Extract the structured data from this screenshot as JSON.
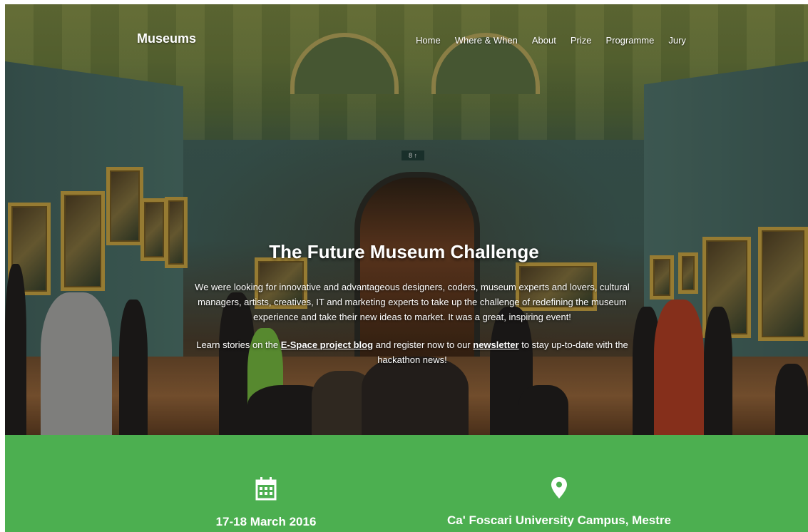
{
  "brand": "Museums",
  "nav": [
    "Home",
    "Where & When",
    "About",
    "Prize",
    "Programme",
    "Jury"
  ],
  "hero": {
    "title": "The Future Museum Challenge",
    "description": "We were looking for innovative and advantageous designers, coders, museum experts and lovers, cultural managers,  artists, creatives, IT and marketing experts to take up the challenge of redefining the museum experience and take their new ideas to market. It was a great, inspiring event!",
    "cta_prefix": "Learn stories on the ",
    "cta_link1": "E-Space project blog",
    "cta_middle": " and register now to our ",
    "cta_link2": "newsletter",
    "cta_suffix": " to stay up-to-date with the hackathon news!"
  },
  "info": {
    "date": "17-18 March 2016",
    "location": "Ca' Foscari University Campus, Mestre",
    "date_icon": "calendar-icon",
    "location_icon": "map-marker-icon"
  },
  "colors": {
    "accent_green": "#4caf50",
    "text_white": "#ffffff"
  }
}
